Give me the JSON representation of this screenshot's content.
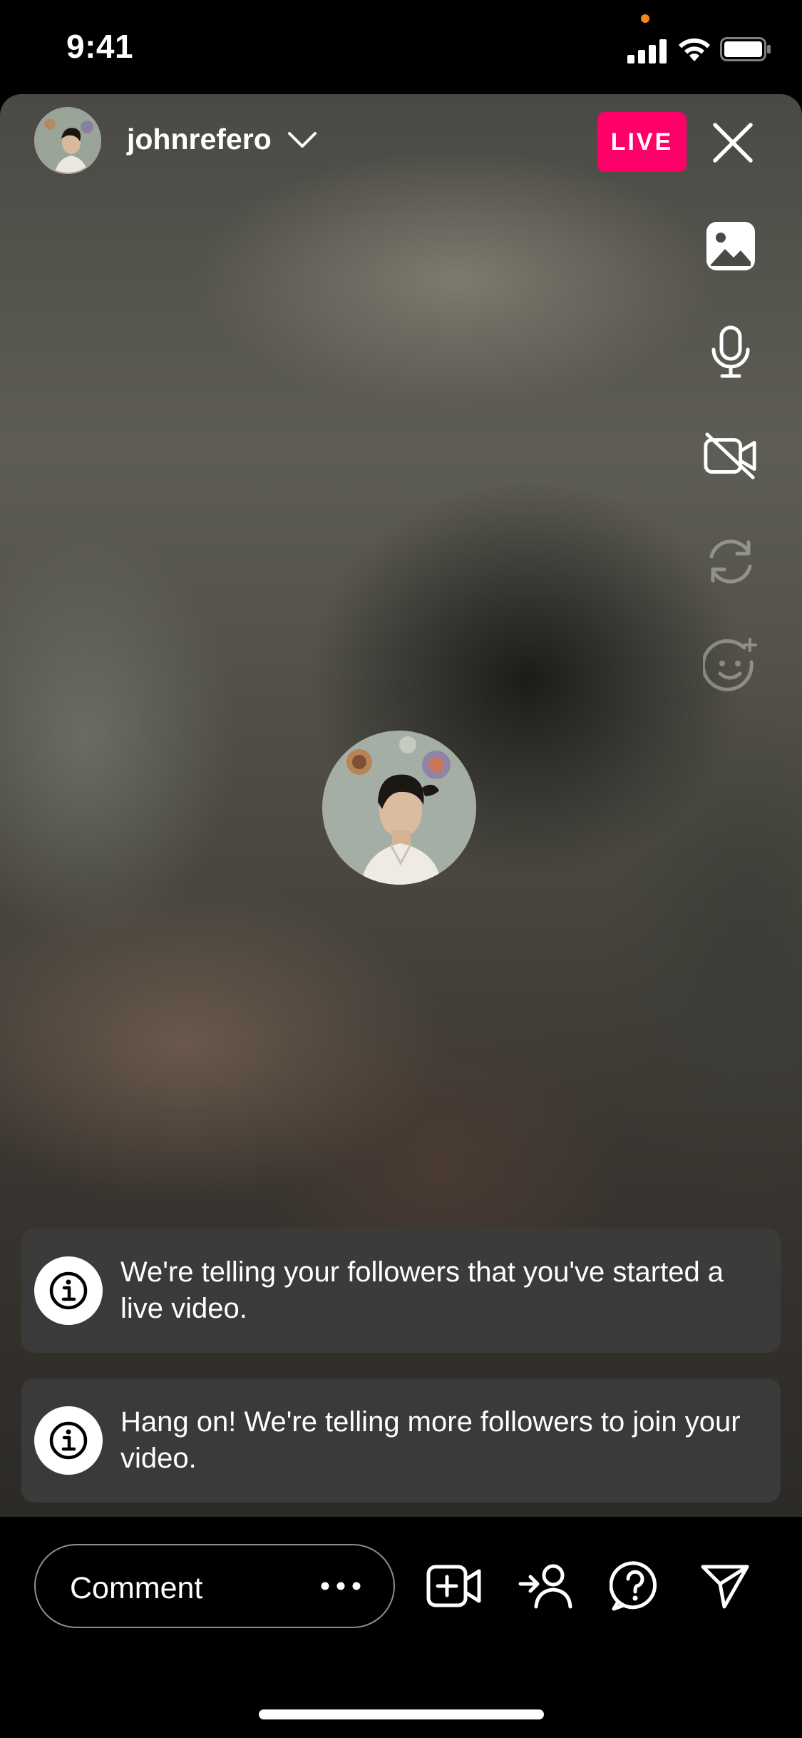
{
  "status_bar": {
    "time": "9:41"
  },
  "header": {
    "username": "johnrefero",
    "live_label": "LIVE"
  },
  "notices": [
    {
      "text": "We're telling your followers that you've started a live video."
    },
    {
      "text": "Hang on! We're telling more followers to join your video."
    }
  ],
  "bottom_bar": {
    "comment_placeholder": "Comment"
  },
  "colors": {
    "live_badge": "#ff0069",
    "privacy_dot": "#f28a1b"
  }
}
